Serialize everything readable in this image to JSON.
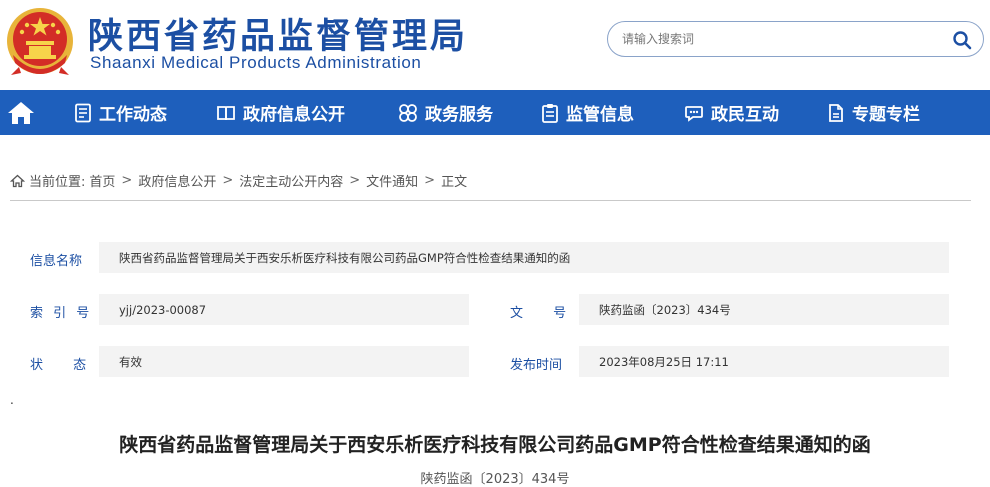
{
  "header": {
    "title_cn": "陕西省药品监督管理局",
    "title_en": "Shaanxi Medical Products Administration",
    "search_placeholder": "请输入搜索词"
  },
  "nav": {
    "items": [
      {
        "label": "工作动态",
        "icon": "document-list-icon"
      },
      {
        "label": "政府信息公开",
        "icon": "book-icon"
      },
      {
        "label": "政务服务",
        "icon": "grid-flower-icon"
      },
      {
        "label": "监管信息",
        "icon": "clipboard-icon"
      },
      {
        "label": "政民互动",
        "icon": "chat-bubble-icon"
      },
      {
        "label": "专题专栏",
        "icon": "folder-icon"
      }
    ]
  },
  "breadcrumb": {
    "prefix": "当前位置:",
    "items": [
      "首页",
      "政府信息公开",
      "法定主动公开内容",
      "文件通知",
      "正文"
    ]
  },
  "info": {
    "name_label": "信息名称",
    "name_value": "陕西省药品监督管理局关于西安乐析医疗科技有限公司药品GMP符合性检查结果通知的函",
    "index_label": "索 引 号",
    "index_value": "yjj/2023-00087",
    "docno_label": "文 号",
    "docno_value": "陕药监函〔2023〕434号",
    "status_label": "状 态",
    "status_value": "有效",
    "date_label": "发布时间",
    "date_value": "2023年08月25日 17:11"
  },
  "article": {
    "title": "陕西省药品监督管理局关于西安乐析医疗科技有限公司药品GMP符合性检查结果通知的函",
    "doc_no": "陕药监函〔2023〕434号"
  },
  "colors": {
    "brand_blue": "#1c4fa3",
    "nav_blue": "#1e5fbc",
    "emblem_red": "#d32d26",
    "emblem_gold": "#f2c94c"
  }
}
